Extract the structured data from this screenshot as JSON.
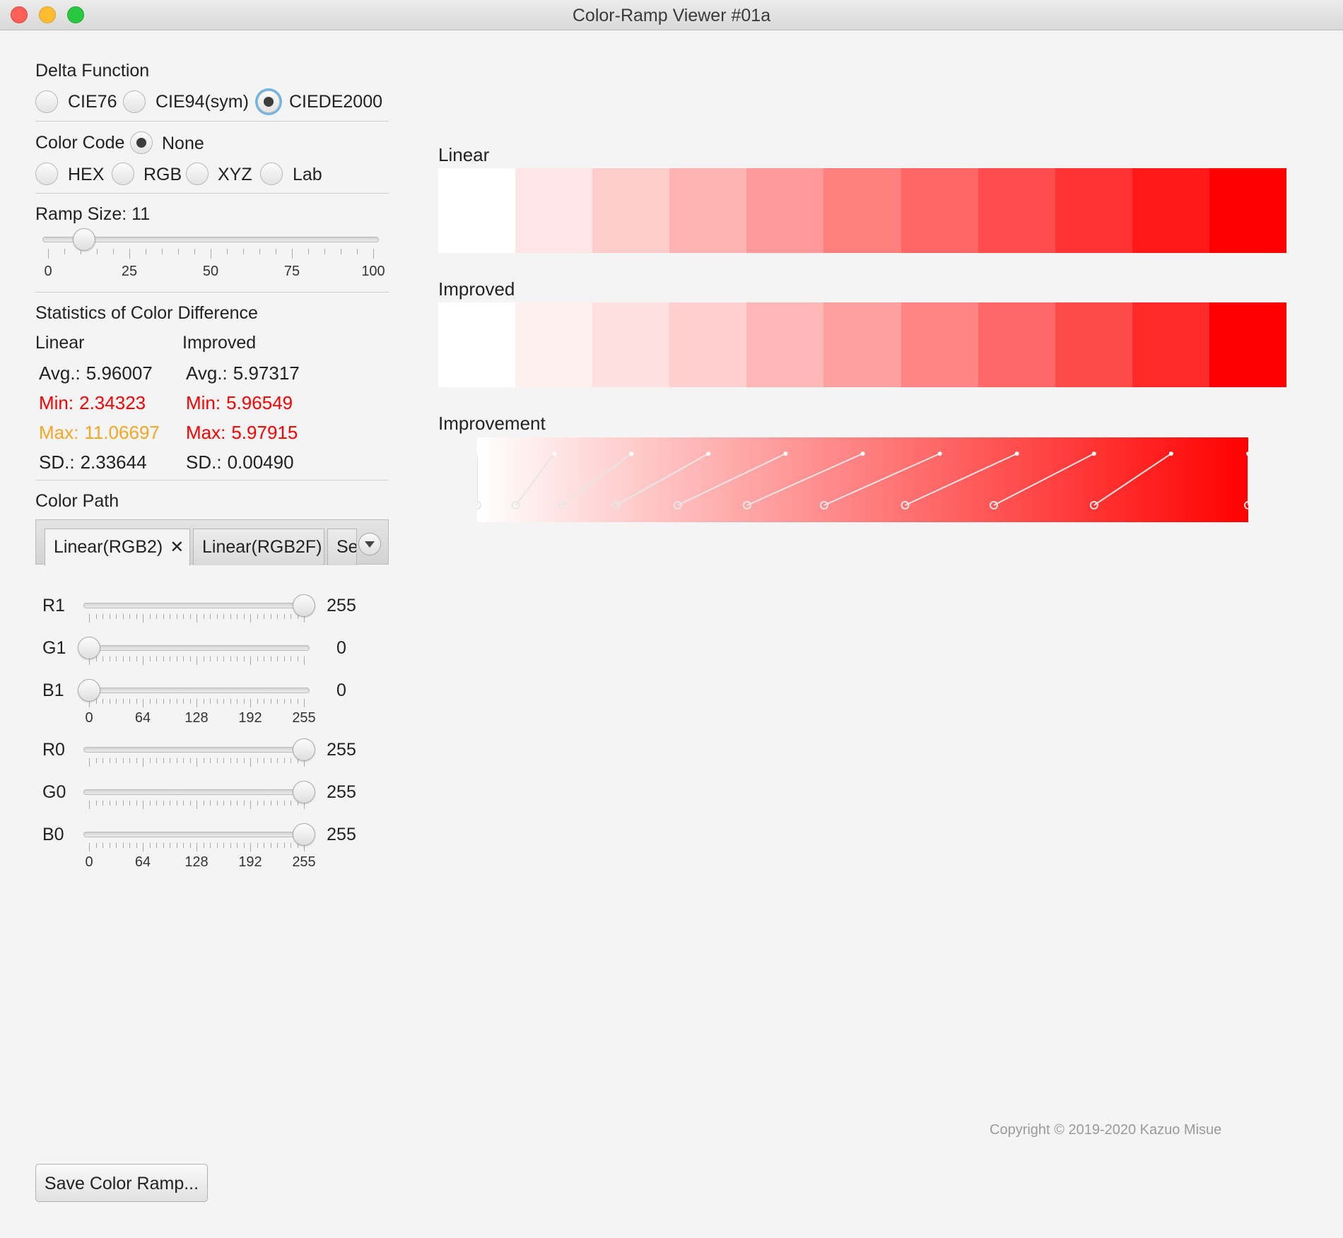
{
  "window": {
    "title": "Color-Ramp Viewer #01a"
  },
  "delta": {
    "label": "Delta Function",
    "options": [
      "CIE76",
      "CIE94(sym)",
      "CIEDE2000"
    ],
    "selected": "CIEDE2000"
  },
  "colorCode": {
    "label": "Color Code",
    "options": [
      "None",
      "HEX",
      "RGB",
      "XYZ",
      "Lab"
    ],
    "selected": "None"
  },
  "ramp": {
    "label": "Ramp Size: 11",
    "value": 11,
    "ticks": [
      "0",
      "25",
      "50",
      "75",
      "100"
    ]
  },
  "stats": {
    "title": "Statistics of Color Difference",
    "linear": {
      "header": "Linear",
      "avg": {
        "label": "Avg.:",
        "value": "5.96007"
      },
      "min": {
        "label": "Min:",
        "value": "2.34323"
      },
      "max": {
        "label": "Max:",
        "value": "11.06697"
      },
      "sd": {
        "label": "SD.:",
        "value": "2.33644"
      }
    },
    "improved": {
      "header": "Improved",
      "avg": {
        "label": "Avg.:",
        "value": "5.97317"
      },
      "min": {
        "label": "Min:",
        "value": "5.96549"
      },
      "max": {
        "label": "Max:",
        "value": "5.97915"
      },
      "sd": {
        "label": "SD.:",
        "value": "0.00490"
      }
    },
    "colors": {
      "min": "#ff0000",
      "maxLinear": "#f5a623",
      "maxImproved": "#ff0000"
    }
  },
  "colorPath": {
    "label": "Color Path",
    "tabs": [
      {
        "label": "Linear(RGB2)",
        "close": "✕"
      },
      {
        "label": "Linear(RGB2F)"
      },
      {
        "label": "Se"
      }
    ]
  },
  "rgb1": {
    "rows": [
      {
        "label": "R1",
        "value": 255
      },
      {
        "label": "G1",
        "value": 0
      },
      {
        "label": "B1",
        "value": 0
      }
    ],
    "ticks": [
      "0",
      "64",
      "128",
      "192",
      "255"
    ]
  },
  "rgb0": {
    "rows": [
      {
        "label": "R0",
        "value": 255
      },
      {
        "label": "G0",
        "value": 255
      },
      {
        "label": "B0",
        "value": 255
      }
    ],
    "ticks": [
      "0",
      "64",
      "128",
      "192",
      "255"
    ]
  },
  "rampsView": {
    "linear": {
      "title": "Linear",
      "colors": [
        "#ffffff",
        "#ffe5e5",
        "#ffcccc",
        "#ffb2b2",
        "#ff9999",
        "#ff7f7f",
        "#ff6666",
        "#ff4c4c",
        "#ff3333",
        "#ff1919",
        "#ff0000"
      ]
    },
    "improved": {
      "title": "Improved",
      "colors": [
        "#ffffff",
        "#fff0f0",
        "#ffe0e0",
        "#ffcfcf",
        "#ffb8b8",
        "#ffa0a0",
        "#ff8585",
        "#ff6868",
        "#ff4a4a",
        "#ff2b2b",
        "#ff0000"
      ]
    },
    "improvement": {
      "title": "Improvement",
      "top": [
        0,
        0.1,
        0.2,
        0.3,
        0.4,
        0.5,
        0.6,
        0.7,
        0.8,
        0.9,
        1.0
      ],
      "bottom": [
        0,
        0.05,
        0.11,
        0.18,
        0.26,
        0.35,
        0.45,
        0.555,
        0.67,
        0.8,
        1.0
      ]
    }
  },
  "footer": {
    "copyright": "Copyright © 2019-2020 Kazuo Misue",
    "save": "Save Color Ramp..."
  }
}
